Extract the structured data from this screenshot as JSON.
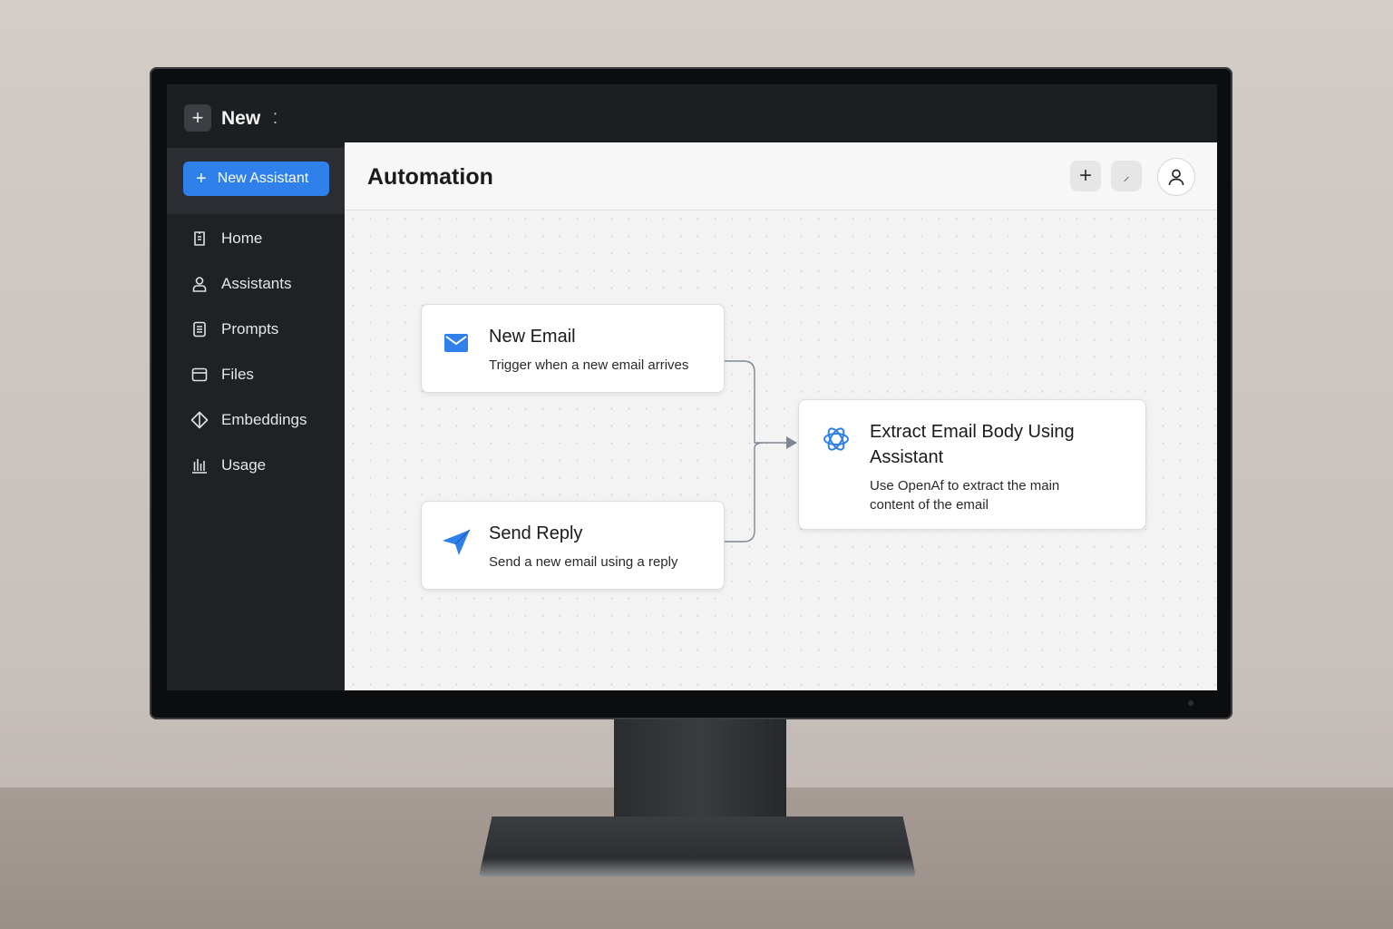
{
  "app": {
    "topbar_title": "New",
    "new_button_label": "New Assistant"
  },
  "sidebar": {
    "items": [
      {
        "label": "Home",
        "icon": "home-icon"
      },
      {
        "label": "Assistants",
        "icon": "user-icon"
      },
      {
        "label": "Prompts",
        "icon": "document-icon"
      },
      {
        "label": "Files",
        "icon": "folder-icon"
      },
      {
        "label": "Embeddings",
        "icon": "diamond-icon"
      },
      {
        "label": "Usage",
        "icon": "bar-chart-icon"
      }
    ]
  },
  "header": {
    "title": "Automation"
  },
  "workflow": {
    "nodes": [
      {
        "id": "new-email",
        "title": "New Email",
        "description": "Trigger when a new email arrives",
        "icon": "mail-icon"
      },
      {
        "id": "send-reply",
        "title": "Send Reply",
        "description": "Send a new email using a reply",
        "icon": "send-icon"
      },
      {
        "id": "extract",
        "title_line1": "Extract Email Body Using",
        "title_line2": "Assistant",
        "description_line1": "Use OpenAf to extract the main",
        "description_line2": "content of the email",
        "icon": "openai-icon"
      }
    ]
  },
  "colors": {
    "accent": "#2f80ea",
    "sidebar_bg": "#1f2225",
    "canvas_bg": "#f3f3f3"
  }
}
